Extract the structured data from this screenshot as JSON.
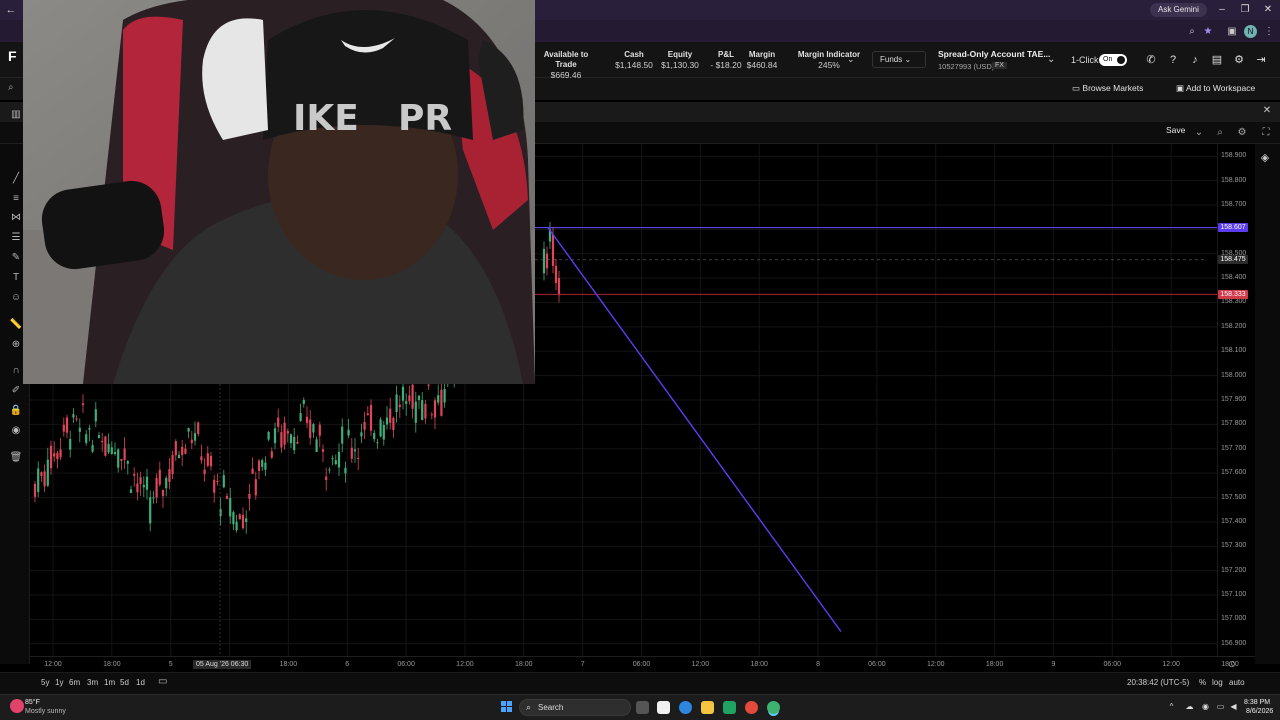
{
  "browser": {
    "ask_gemini": "Ask Gemini",
    "profile_initial": "N"
  },
  "header": {
    "logo": "F",
    "metrics": [
      {
        "label": "Available to Trade",
        "value": "$669.46"
      },
      {
        "label": "Cash",
        "value": "$1,148.50"
      },
      {
        "label": "Equity",
        "value": "$1,130.30"
      },
      {
        "label": "P&L",
        "value": "- $18.20"
      },
      {
        "label": "Margin",
        "value": "$460.84"
      },
      {
        "label": "Margin Indicator",
        "value": "245%"
      }
    ],
    "funds_label": "Funds",
    "account_name": "Spread-Only Account TAE...",
    "account_id": "10527993 (USD)",
    "account_type": "FX",
    "one_click_label": "1-Click",
    "one_click_state": "On"
  },
  "subbar": {
    "browse_markets": "Browse Markets",
    "add_workspace": "Add to Workspace"
  },
  "chart_toolbar": {
    "save_label": "Save"
  },
  "chart_data": {
    "type": "line",
    "y_axis_ticks": [
      "158.900",
      "158.800",
      "158.700",
      "158.600",
      "158.500",
      "158.400",
      "158.300",
      "158.200",
      "158.100",
      "158.000",
      "157.900",
      "157.800",
      "157.700",
      "157.600",
      "157.500",
      "157.400",
      "157.300",
      "157.200",
      "157.100",
      "157.000",
      "156.900"
    ],
    "ylim": [
      156.85,
      158.95
    ],
    "x_axis_ticks": [
      "12:00",
      "18:00",
      "5",
      "12:00",
      "18:00",
      "6",
      "06:00",
      "12:00",
      "18:00",
      "7",
      "06:00",
      "12:00",
      "18:00",
      "8",
      "06:00",
      "12:00",
      "18:00",
      "9",
      "06:00",
      "12:00",
      "18:00"
    ],
    "crosshair_time": "05 Aug '26   06:30",
    "price_tags": [
      {
        "value": "158.607",
        "color": "#5b3cf0"
      },
      {
        "value": "158.475",
        "color": "#2b2b2b"
      },
      {
        "value": "158.333",
        "color": "#d23a4a"
      }
    ],
    "horizontal_lines": [
      {
        "value": 158.607,
        "color": "#6a4bff"
      },
      {
        "value": 158.333,
        "color": "#b02030"
      }
    ],
    "trend_line": {
      "from": 158.607,
      "to": 156.95,
      "color": "#5a3ff0"
    }
  },
  "bottom_bar": {
    "ranges": [
      "5y",
      "1y",
      "6m",
      "3m",
      "1m",
      "5d",
      "1d"
    ],
    "clock": "20:38:42 (UTC-5)",
    "percent": "%",
    "log": "log",
    "auto": "auto"
  },
  "taskbar": {
    "temperature": "85°F",
    "weather": "Mostly sunny",
    "search_label": "Search",
    "time": "8:38 PM",
    "date": "8/6/2026"
  }
}
